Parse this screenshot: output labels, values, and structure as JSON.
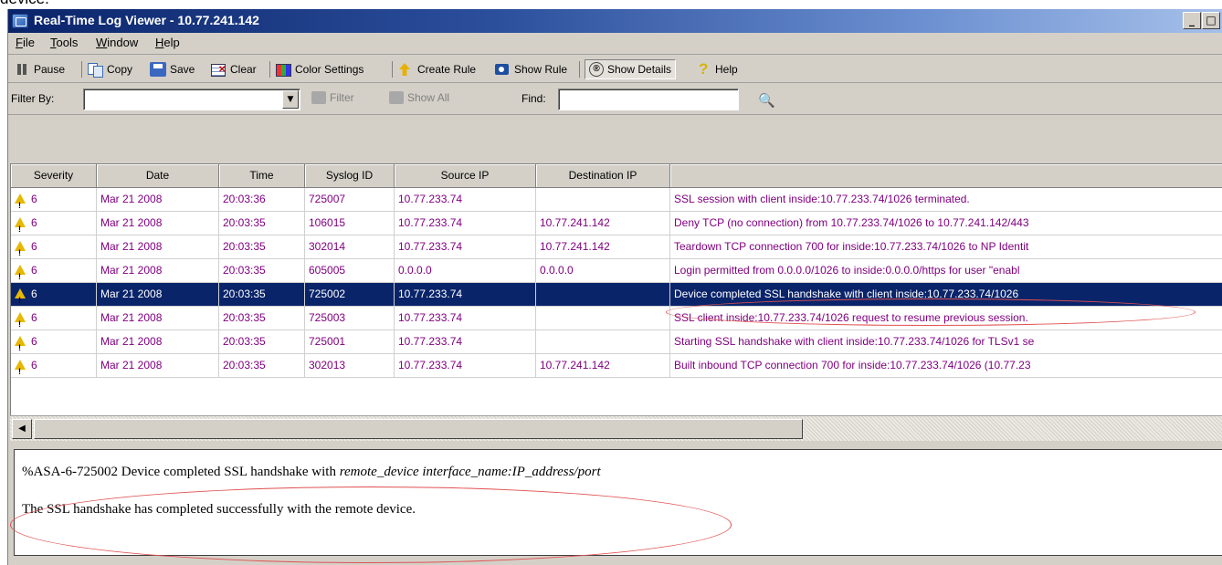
{
  "caption_fragment": "device.",
  "window": {
    "title": "Real-Time Log Viewer - 10.77.241.142",
    "minimize": "_",
    "maximize": "□"
  },
  "menu": [
    "File",
    "Tools",
    "Window",
    "Help"
  ],
  "toolbar": {
    "pause": "Pause",
    "copy": "Copy",
    "save": "Save",
    "clear": "Clear",
    "color_settings": "Color Settings",
    "create_rule": "Create Rule",
    "show_rule": "Show Rule",
    "show_details": "Show Details",
    "help": "Help"
  },
  "filterbar": {
    "filter_by_label": "Filter By:",
    "filter_by_value": "",
    "filter_button": "Filter",
    "show_all_button": "Show All",
    "find_label": "Find:",
    "find_value": ""
  },
  "table": {
    "columns": [
      "Severity",
      "Date",
      "Time",
      "Syslog ID",
      "Source IP",
      "Destination IP",
      ""
    ],
    "rows": [
      {
        "severity": "6",
        "date": "Mar 21 2008",
        "time": "20:03:36",
        "syslog_id": "725007",
        "src": "10.77.233.74",
        "dst": "",
        "msg": "SSL session with client inside:10.77.233.74/1026 terminated."
      },
      {
        "severity": "6",
        "date": "Mar 21 2008",
        "time": "20:03:35",
        "syslog_id": "106015",
        "src": "10.77.233.74",
        "dst": "10.77.241.142",
        "msg": "Deny TCP (no connection) from 10.77.233.74/1026 to 10.77.241.142/443"
      },
      {
        "severity": "6",
        "date": "Mar 21 2008",
        "time": "20:03:35",
        "syslog_id": "302014",
        "src": "10.77.233.74",
        "dst": "10.77.241.142",
        "msg": "Teardown TCP connection 700 for inside:10.77.233.74/1026 to NP Identit"
      },
      {
        "severity": "6",
        "date": "Mar 21 2008",
        "time": "20:03:35",
        "syslog_id": "605005",
        "src": "0.0.0.0",
        "dst": "0.0.0.0",
        "msg": "Login permitted from 0.0.0.0/1026 to inside:0.0.0.0/https for user \"enabl"
      },
      {
        "severity": "6",
        "date": "Mar 21 2008",
        "time": "20:03:35",
        "syslog_id": "725002",
        "src": "10.77.233.74",
        "dst": "",
        "msg": "Device completed SSL handshake with client inside:10.77.233.74/1026"
      },
      {
        "severity": "6",
        "date": "Mar 21 2008",
        "time": "20:03:35",
        "syslog_id": "725003",
        "src": "10.77.233.74",
        "dst": "",
        "msg": "SSL client inside:10.77.233.74/1026 request to resume previous session."
      },
      {
        "severity": "6",
        "date": "Mar 21 2008",
        "time": "20:03:35",
        "syslog_id": "725001",
        "src": "10.77.233.74",
        "dst": "",
        "msg": "Starting SSL handshake with client inside:10.77.233.74/1026 for TLSv1 se"
      },
      {
        "severity": "6",
        "date": "Mar 21 2008",
        "time": "20:03:35",
        "syslog_id": "302013",
        "src": "10.77.233.74",
        "dst": "10.77.241.142",
        "msg": "Built inbound TCP connection 700 for inside:10.77.233.74/1026 (10.77.23"
      }
    ],
    "selected_index": 4
  },
  "details": {
    "line1_prefix": "%ASA-6-725002 Device completed SSL handshake with ",
    "line1_italic": "remote_device interface_name:IP_address/port",
    "line2": "The SSL handshake has completed successfully with the remote device."
  },
  "colors": {
    "selected_row_bg": "#0a246a",
    "row_text": "#800080",
    "annotation": "#e05050"
  }
}
